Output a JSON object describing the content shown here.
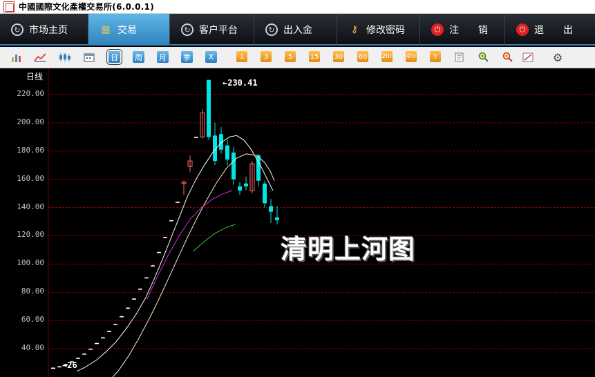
{
  "window": {
    "title": "中國國際文化產權交易所(6.0.0.1)"
  },
  "nav": [
    {
      "label": "市场主页",
      "icon": "refresh-circle-icon"
    },
    {
      "label": "交易",
      "icon": "grid-icon",
      "active": true
    },
    {
      "label": "客户平台",
      "icon": "refresh-circle-icon"
    },
    {
      "label": "出入金",
      "icon": "refresh-circle-icon"
    },
    {
      "label": "修改密码",
      "icon": "key-icon"
    },
    {
      "label": "注　　销",
      "icon": "power-icon"
    },
    {
      "label": "退　　出",
      "icon": "power-icon"
    }
  ],
  "toolbar": {
    "periods": [
      "日",
      "周",
      "月",
      "季",
      "X"
    ],
    "selected_period": "日",
    "minutes": [
      "1",
      "3",
      "5",
      "15",
      "30",
      "60",
      "2hr",
      "4hr",
      "Y"
    ]
  },
  "chart_data": {
    "type": "candlestick",
    "title": "日线",
    "ylim": [
      25,
      235
    ],
    "yticks": [
      "220.00",
      "200.00",
      "180.00",
      "160.00",
      "140.00",
      "120.00",
      "100.00",
      "80.00",
      "60.00",
      "40.00"
    ],
    "peak_label": "230.41",
    "start_label": "26",
    "up_color": "#ff6a6a",
    "down_color": "#00e5e5",
    "grid_color": "#8b0000",
    "candles": [
      {
        "o": 26.5,
        "c": 26.5,
        "h": 26.8,
        "l": 26.2
      },
      {
        "o": 27.5,
        "c": 27.5,
        "h": 27.8,
        "l": 27.2
      },
      {
        "o": 29,
        "c": 29,
        "h": 29.3,
        "l": 28.7
      },
      {
        "o": 31,
        "c": 31,
        "h": 31.3,
        "l": 30.7
      },
      {
        "o": 33.5,
        "c": 33.5,
        "h": 33.8,
        "l": 33.2
      },
      {
        "o": 36.5,
        "c": 36.5,
        "h": 36.8,
        "l": 36.2
      },
      {
        "o": 40,
        "c": 40,
        "h": 40.3,
        "l": 39.7
      },
      {
        "o": 44,
        "c": 44,
        "h": 44.3,
        "l": 43.7
      },
      {
        "o": 48,
        "c": 48,
        "h": 48.3,
        "l": 47.7
      },
      {
        "o": 52.5,
        "c": 52.5,
        "h": 52.8,
        "l": 52.2
      },
      {
        "o": 57.5,
        "c": 57.5,
        "h": 57.8,
        "l": 57.2
      },
      {
        "o": 63,
        "c": 63,
        "h": 63.3,
        "l": 62.7
      },
      {
        "o": 69,
        "c": 69,
        "h": 69.3,
        "l": 68.7
      },
      {
        "o": 75.5,
        "c": 75.5,
        "h": 75.8,
        "l": 75.2
      },
      {
        "o": 82.5,
        "c": 82.5,
        "h": 82.8,
        "l": 82.2
      },
      {
        "o": 90.5,
        "c": 90.5,
        "h": 90.8,
        "l": 90.2
      },
      {
        "o": 99,
        "c": 99,
        "h": 99.3,
        "l": 98.7
      },
      {
        "o": 108.5,
        "c": 108.5,
        "h": 108.8,
        "l": 108.2
      },
      {
        "o": 119,
        "c": 119,
        "h": 119.3,
        "l": 118.7
      },
      {
        "o": 131,
        "c": 131,
        "h": 131.3,
        "l": 130.7
      },
      {
        "o": 144,
        "c": 144,
        "h": 144.3,
        "l": 143.7
      },
      {
        "o": 157,
        "c": 158,
        "h": 159,
        "l": 149
      },
      {
        "o": 169,
        "c": 173,
        "h": 177,
        "l": 165
      },
      {
        "o": 190,
        "c": 190,
        "h": 190.3,
        "l": 189.7
      },
      {
        "o": 190,
        "c": 207,
        "h": 210,
        "l": 189
      },
      {
        "o": 230.41,
        "c": 190,
        "h": 230.41,
        "l": 188
      },
      {
        "o": 191,
        "c": 173,
        "h": 200,
        "l": 170
      },
      {
        "o": 192,
        "c": 181,
        "h": 197,
        "l": 178
      },
      {
        "o": 184,
        "c": 174,
        "h": 188,
        "l": 170
      },
      {
        "o": 179,
        "c": 160,
        "h": 183,
        "l": 156
      },
      {
        "o": 155,
        "c": 152,
        "h": 158,
        "l": 149
      },
      {
        "o": 157,
        "c": 155,
        "h": 162,
        "l": 152
      },
      {
        "o": 152,
        "c": 171,
        "h": 173,
        "l": 150
      },
      {
        "o": 177,
        "c": 159,
        "h": 178,
        "l": 155
      },
      {
        "o": 157,
        "c": 143,
        "h": 159,
        "l": 140
      },
      {
        "o": 141,
        "c": 137,
        "h": 146,
        "l": 129
      },
      {
        "o": 133,
        "c": 131,
        "h": 141,
        "l": 128
      }
    ],
    "ma_white": [
      [
        17,
        24
      ],
      [
        23,
        27
      ],
      [
        31,
        32
      ],
      [
        38,
        38
      ],
      [
        45,
        45
      ],
      [
        52,
        54
      ],
      [
        59,
        64
      ],
      [
        66,
        76
      ],
      [
        72,
        89
      ],
      [
        78,
        103
      ],
      [
        84,
        118
      ],
      [
        90,
        133
      ],
      [
        96,
        148
      ],
      [
        102,
        160
      ],
      [
        108,
        170
      ],
      [
        114,
        179
      ],
      [
        120,
        186
      ],
      [
        126,
        190
      ],
      [
        131,
        191
      ],
      [
        136,
        188
      ],
      [
        141,
        182
      ],
      [
        145,
        175
      ],
      [
        149,
        168
      ],
      [
        152,
        162
      ],
      [
        155,
        156
      ],
      [
        157,
        152
      ]
    ],
    "ma_pale": [
      [
        33,
        10
      ],
      [
        40,
        17
      ],
      [
        47,
        25
      ],
      [
        54,
        35
      ],
      [
        61,
        47
      ],
      [
        68,
        60
      ],
      [
        75,
        74
      ],
      [
        82,
        89
      ],
      [
        89,
        104
      ],
      [
        96,
        119
      ],
      [
        103,
        133
      ],
      [
        110,
        146
      ],
      [
        117,
        158
      ],
      [
        124,
        168
      ],
      [
        131,
        175
      ],
      [
        138,
        178
      ],
      [
        145,
        177
      ],
      [
        151,
        172
      ],
      [
        155,
        166
      ],
      [
        158,
        159
      ]
    ],
    "ma_purple": [
      [
        67,
        75
      ],
      [
        74,
        90
      ],
      [
        82,
        106
      ],
      [
        90,
        120
      ],
      [
        98,
        132
      ],
      [
        106,
        140
      ],
      [
        114,
        146
      ],
      [
        122,
        150
      ],
      [
        128,
        152
      ]
    ],
    "ma_green": [
      [
        100,
        109
      ],
      [
        108,
        116
      ],
      [
        116,
        122
      ],
      [
        124,
        126
      ],
      [
        130,
        128
      ]
    ]
  }
}
